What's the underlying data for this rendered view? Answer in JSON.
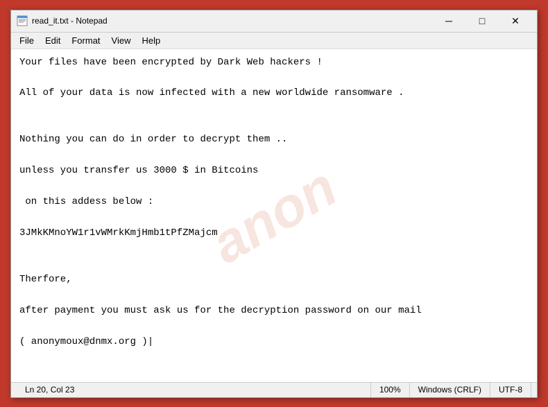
{
  "titleBar": {
    "icon": "notepad",
    "title": "read_it.txt - Notepad",
    "minimizeLabel": "─",
    "maximizeLabel": "□",
    "closeLabel": "✕"
  },
  "menuBar": {
    "items": [
      "File",
      "Edit",
      "Format",
      "View",
      "Help"
    ]
  },
  "editor": {
    "content": "Your files have been encrypted by Dark Web hackers !\n\nAll of your data is now infected with a new worldwide ransomware .\n\n\nNothing you can do in order to decrypt them ..\n\nunless you transfer us 3000 $ in Bitcoins\n\n on this addess below :\n\n3JMkKMnoYW1r1vWMrkKmjHmb1tPfZMajcm\n\n\nTherfore,\n\nafter payment you must ask us for the decryption password on our mail\n\n( anonymoux@dnmx.org )|",
    "watermark": "anon"
  },
  "statusBar": {
    "position": "Ln 20, Col 23",
    "zoom": "100%",
    "lineEnding": "Windows (CRLF)",
    "encoding": "UTF-8"
  }
}
